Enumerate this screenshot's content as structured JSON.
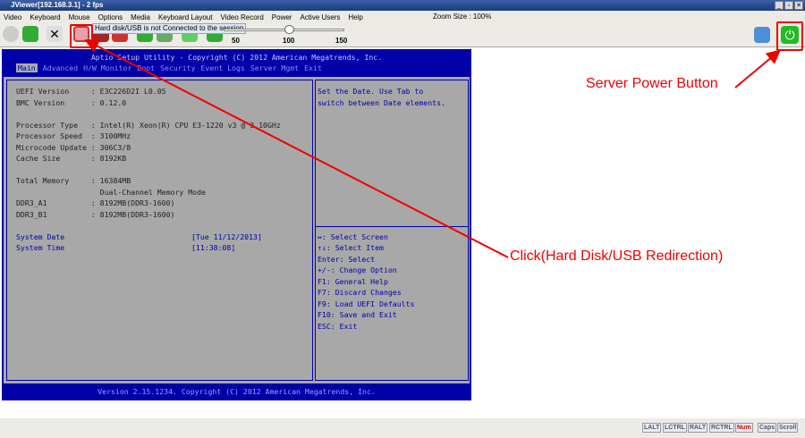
{
  "window": {
    "title": "JViewer[192.168.3.1] - 2 fps",
    "controls": [
      "_",
      "▫",
      "✕"
    ]
  },
  "menu": [
    "Video",
    "Keyboard",
    "Mouse",
    "Options",
    "Media",
    "Keyboard Layout",
    "Video Record",
    "Power",
    "Active Users",
    "Help"
  ],
  "zoom_size": "Zoom Size : 100%",
  "tooltip": "Hard disk/USB is not Connected to the session",
  "slider": {
    "ticks": [
      "50",
      "100",
      "150"
    ],
    "value": 100
  },
  "bios": {
    "header": "Aptio Setup Utility - Copyright (C) 2012 American Megatrends, Inc.",
    "tabs": [
      "Main",
      "Advanced",
      "H/W Monitor",
      "Boot",
      "Security",
      "Event Logs",
      "Server Mgmt",
      "Exit"
    ],
    "lines": [
      "UEFI Version     : E3C226D2I L0.05",
      "BMC Version      : 0.12.0",
      "Processor Type   : Intel(R) Xeon(R) CPU E3-1220 v3 @ 3.10GHz",
      "Processor Speed  : 3100MHz",
      "Microcode Update : 306C3/8",
      "Cache Size       : 8192KB",
      "Total Memory     : 16384MB",
      "                   Dual-Channel Memory Mode",
      "DDR3_A1          : 8192MB(DDR3-1600)",
      "DDR3_B1          : 8192MB(DDR3-1600)"
    ],
    "system_date_label": "System Date",
    "system_date_value": "[Tue 11/12/2013]",
    "system_time_label": "System Time",
    "system_time_value": "[11:38:08]",
    "help": [
      "Set the Date. Use Tab to",
      "switch between Date elements."
    ],
    "keys": [
      "↔: Select Screen",
      "↑↓: Select Item",
      "Enter: Select",
      "+/-: Change Option",
      "F1: General Help",
      "F7: Discard Changes",
      "F9: Load UEFI Defaults",
      "F10: Save and Exit",
      "ESC: Exit"
    ],
    "footer": "Version 2.15.1234. Copyright (C) 2012 American Megatrends, Inc."
  },
  "status_keys": [
    "LALT",
    "LCTRL",
    "RALT",
    "RCTRL",
    "Num",
    "Caps",
    "Scroll"
  ],
  "annotations": {
    "power": "Server Power Button",
    "hdd": "Click(Hard Disk/USB Redirection)"
  }
}
